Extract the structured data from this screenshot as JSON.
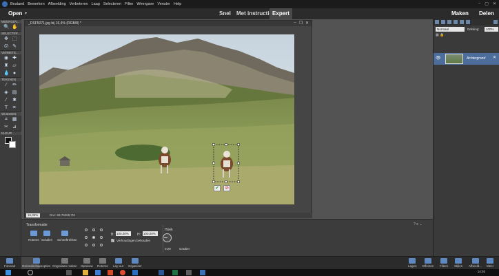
{
  "menubar": {
    "items": [
      "Bestand",
      "Bewerken",
      "Afbeelding",
      "Verbeteren",
      "Laag",
      "Selecteren",
      "Filter",
      "Weergave",
      "Venster",
      "Help"
    ]
  },
  "modebar": {
    "open_label": "Open",
    "modes": [
      "Snel",
      "Met instructies",
      "Expert"
    ],
    "maken_label": "Maken",
    "delen_label": "Delen"
  },
  "toolbox": {
    "sections": [
      "WEERGEV...",
      "SELECTER...",
      "VERBETE...",
      "TEKENEN",
      "WIJZIGEN",
      "KLEUR"
    ]
  },
  "document": {
    "title": "_DSF5071.jpg bij 16,4% (RGB/8) *",
    "zoom": "16,36%",
    "docsize": "Doc: 68,7M/68,7M"
  },
  "layers": {
    "blend_mode": "Normaal",
    "opacity_label": "Dekking:",
    "opacity_value": "100%",
    "layer_name": "Achtergrond"
  },
  "tool_options": {
    "title": "Transformatie",
    "buttons": [
      "Roteren",
      "Schalen",
      "Scheeftrekken"
    ],
    "width_label": "B:",
    "width_value": "100,00%",
    "height_label": "H:",
    "height_value": "100,00%",
    "keep_proportions_label": "Verhoudingen behouden",
    "angle_label": "Hoek",
    "angle_value": "0,00",
    "angle_unit": "Graden"
  },
  "bottombar": {
    "left_items": [
      "Fotovak",
      "Gereedschapsopties",
      "Ongedaan maken",
      "Opnieuw",
      "Roteren",
      "Lay-out",
      "Organizer"
    ],
    "right_items": [
      "Lagen",
      "Effecten",
      "Filters",
      "Stijlen",
      "Afbeeld...",
      "Meer"
    ]
  },
  "taskbar": {
    "clock": "14:02"
  },
  "colors": {
    "accent": "#4d6e9c",
    "menubar": "#1b1b1b",
    "panel": "#3c3c3c",
    "commit_green": "#3a9a2a",
    "cancel_red": "#c0302a"
  }
}
